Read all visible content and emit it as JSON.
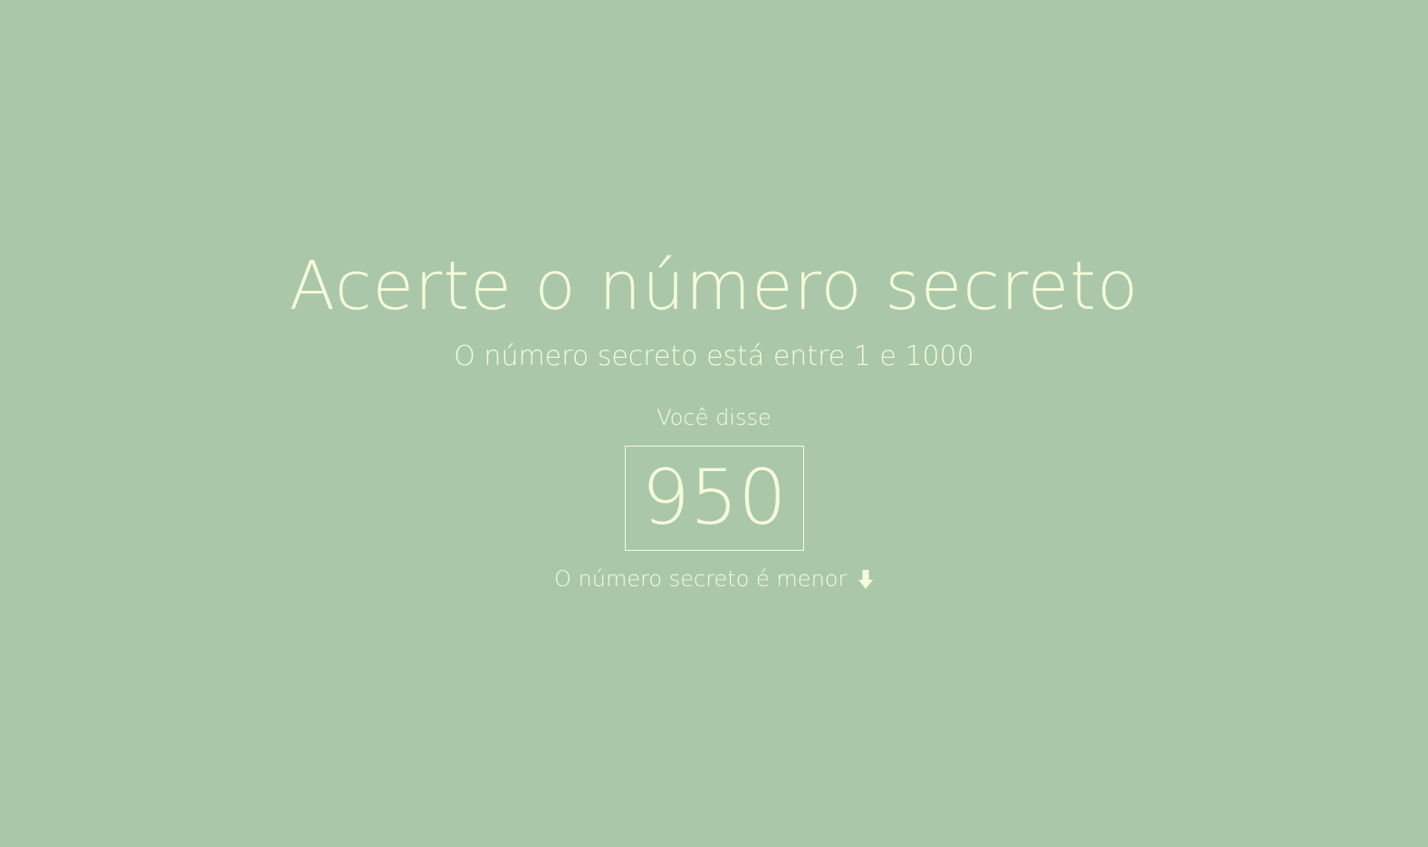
{
  "page": {
    "background_color": "#aac8a9",
    "text_color": "#f5fcd9"
  },
  "game": {
    "title": "Acerte o número secreto",
    "subtitle": "O número secreto está entre 1 e 1000",
    "said_label": "Você disse",
    "guess": "950",
    "hint": "O número secreto é menor",
    "hint_icon": "arrow-down-icon"
  }
}
